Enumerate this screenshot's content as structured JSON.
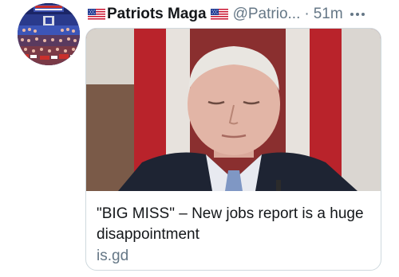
{
  "tweet": {
    "display_name": "Patriots Maga",
    "handle": "@Patrio...",
    "separator": "·",
    "time": "51m",
    "flag_icon": "us-flag-icon",
    "more_icon": "more-options-icon"
  },
  "card": {
    "title": "\"BIG MISS\" – New jobs report is a huge disappointment",
    "domain": "is.gd"
  },
  "colors": {
    "text_primary": "#14171a",
    "text_secondary": "#657786",
    "card_border": "#cfd9de"
  }
}
